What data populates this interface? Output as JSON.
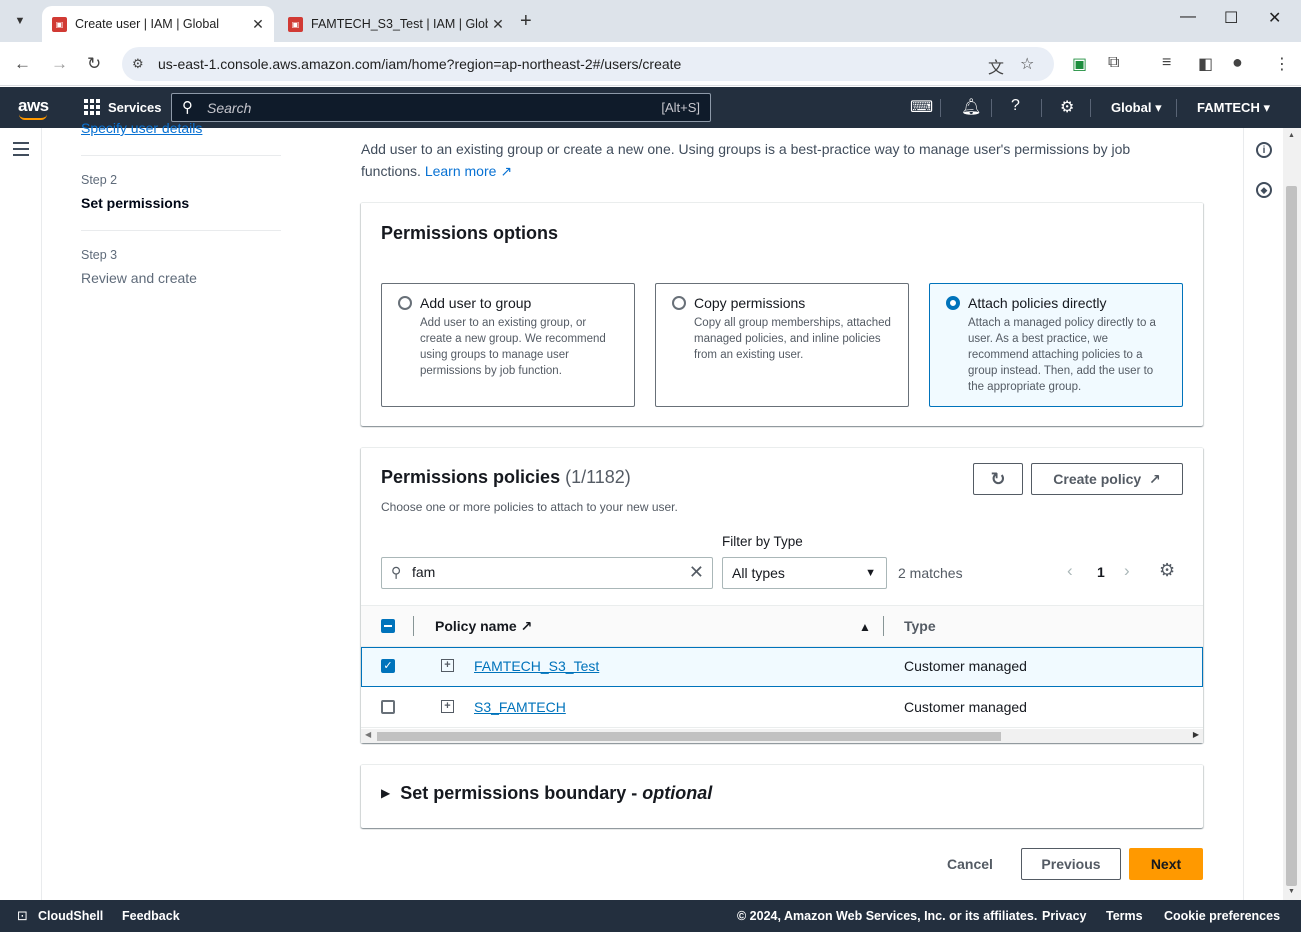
{
  "browser": {
    "tabs": [
      {
        "title": "Create user | IAM | Global",
        "favicon": "aws-iam-icon"
      },
      {
        "title": "FAMTECH_S3_Test | IAM | Global",
        "favicon": "aws-iam-icon"
      }
    ],
    "url": "us-east-1.console.aws.amazon.com/iam/home?region=ap-northeast-2#/users/create"
  },
  "aws_header": {
    "logo": "aws",
    "services_label": "Services",
    "search_placeholder": "Search",
    "search_shortcut": "[Alt+S]",
    "region_label": "Global",
    "account_label": "FAMTECH"
  },
  "steps": {
    "step1_link": "Specify user details",
    "step2_num": "Step 2",
    "step2_title": "Set permissions",
    "step3_num": "Step 3",
    "step3_title": "Review and create"
  },
  "intro": {
    "text": "Add user to an existing group or create a new one. Using groups is a best-practice way to manage user's permissions by job functions.",
    "learn_more": "Learn more"
  },
  "permissions_options": {
    "title": "Permissions options",
    "options": [
      {
        "title": "Add user to group",
        "desc": "Add user to an existing group, or create a new group. We recommend using groups to manage user permissions by job function.",
        "selected": false
      },
      {
        "title": "Copy permissions",
        "desc": "Copy all group memberships, attached managed policies, and inline policies from an existing user.",
        "selected": false
      },
      {
        "title": "Attach policies directly",
        "desc": "Attach a managed policy directly to a user. As a best practice, we recommend attaching policies to a group instead. Then, add the user to the appropriate group.",
        "selected": true
      }
    ]
  },
  "policies": {
    "title": "Permissions policies",
    "count": "(1/1182)",
    "desc": "Choose one or more policies to attach to your new user.",
    "create_policy_label": "Create policy",
    "filter_label": "Filter by Type",
    "search_value": "fam",
    "filter_value": "All types",
    "matches": "2 matches",
    "page": "1",
    "columns": {
      "name": "Policy name",
      "type": "Type"
    },
    "rows": [
      {
        "name": "FAMTECH_S3_Test",
        "type": "Customer managed",
        "checked": true
      },
      {
        "name": "S3_FAMTECH",
        "type": "Customer managed",
        "checked": false
      }
    ]
  },
  "boundary": {
    "title": "Set permissions boundary - ",
    "optional": "optional"
  },
  "actions": {
    "cancel": "Cancel",
    "previous": "Previous",
    "next": "Next"
  },
  "footer": {
    "cloudshell": "CloudShell",
    "feedback": "Feedback",
    "copyright": "© 2024, Amazon Web Services, Inc. or its affiliates.",
    "privacy": "Privacy",
    "terms": "Terms",
    "cookies": "Cookie preferences"
  },
  "colors": {
    "aws_nav": "#232f3e",
    "accent_orange": "#ff9900",
    "link_blue": "#0972d3",
    "selected_blue": "#0073bb"
  }
}
